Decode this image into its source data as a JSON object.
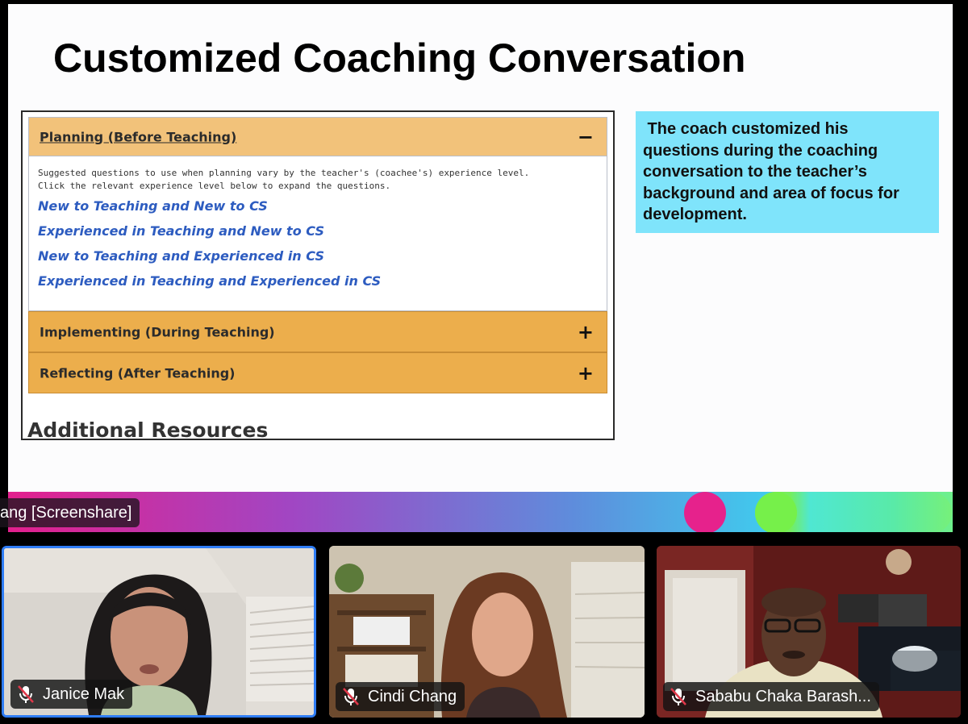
{
  "slide": {
    "title": "Customized Coaching Conversation",
    "accordion": {
      "planning": {
        "label": "Planning (Before Teaching)",
        "toggle": "−",
        "instructions": "Suggested questions to use when planning vary by the teacher's (coachee's) experience level.\nClick the relevant experience level below to expand the questions.",
        "levels": [
          "New to Teaching and New to CS",
          "Experienced in Teaching and New to CS",
          "New to Teaching and Experienced in CS",
          "Experienced in Teaching and Experienced in CS"
        ]
      },
      "implementing": {
        "label": "Implementing (During Teaching)",
        "toggle": "+"
      },
      "reflecting": {
        "label": "Reflecting (After Teaching)",
        "toggle": "+"
      }
    },
    "additional_resources": "Additional Resources",
    "callout": " The coach customized his\nquestions during the coaching\nconversation to the teacher’s\nbackground and area of focus for\ndevelopment.",
    "colors": {
      "accordion_header": "#ecae4c",
      "accordion_active": "#f2c27a",
      "link": "#2d5cc0",
      "callout_bg": "#7fe4fb"
    }
  },
  "screenshare": {
    "label": "ang [Screenshare]"
  },
  "participants": [
    {
      "name": "Janice Mak",
      "mic": "mic-muted-icon",
      "active_speaker": true
    },
    {
      "name": "Cindi Chang",
      "mic": "mic-muted-icon",
      "active_speaker": false
    },
    {
      "name": "Sababu Chaka Barash...",
      "mic": "mic-muted-icon",
      "active_speaker": false
    }
  ]
}
